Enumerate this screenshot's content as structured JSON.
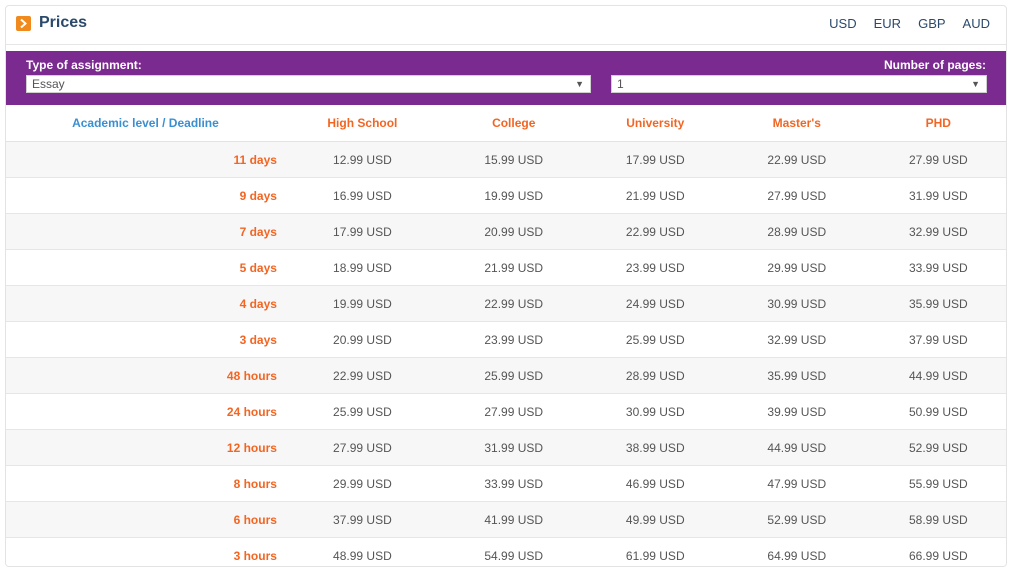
{
  "header": {
    "title": "Prices",
    "icon": "chevron-right-icon",
    "currencies": [
      "USD",
      "EUR",
      "GBP",
      "AUD"
    ]
  },
  "filters": {
    "assignment_label": "Type of assignment:",
    "assignment_value": "Essay",
    "pages_label": "Number of pages:",
    "pages_value": "1"
  },
  "table": {
    "headers": [
      "Academic level / Deadline",
      "High School",
      "College",
      "University",
      "Master's",
      "PHD"
    ],
    "rows": [
      [
        "11 days",
        "12.99 USD",
        "15.99 USD",
        "17.99 USD",
        "22.99 USD",
        "27.99 USD"
      ],
      [
        "9 days",
        "16.99 USD",
        "19.99 USD",
        "21.99 USD",
        "27.99 USD",
        "31.99 USD"
      ],
      [
        "7 days",
        "17.99 USD",
        "20.99 USD",
        "22.99 USD",
        "28.99 USD",
        "32.99 USD"
      ],
      [
        "5 days",
        "18.99 USD",
        "21.99 USD",
        "23.99 USD",
        "29.99 USD",
        "33.99 USD"
      ],
      [
        "4 days",
        "19.99 USD",
        "22.99 USD",
        "24.99 USD",
        "30.99 USD",
        "35.99 USD"
      ],
      [
        "3 days",
        "20.99 USD",
        "23.99 USD",
        "25.99 USD",
        "32.99 USD",
        "37.99 USD"
      ],
      [
        "48 hours",
        "22.99 USD",
        "25.99 USD",
        "28.99 USD",
        "35.99 USD",
        "44.99 USD"
      ],
      [
        "24 hours",
        "25.99 USD",
        "27.99 USD",
        "30.99 USD",
        "39.99 USD",
        "50.99 USD"
      ],
      [
        "12 hours",
        "27.99 USD",
        "31.99 USD",
        "38.99 USD",
        "44.99 USD",
        "52.99 USD"
      ],
      [
        "8 hours",
        "29.99 USD",
        "33.99 USD",
        "46.99 USD",
        "47.99 USD",
        "55.99 USD"
      ],
      [
        "6 hours",
        "37.99 USD",
        "41.99 USD",
        "49.99 USD",
        "52.99 USD",
        "58.99 USD"
      ],
      [
        "3 hours",
        "48.99 USD",
        "54.99 USD",
        "61.99 USD",
        "64.99 USD",
        "66.99 USD"
      ]
    ]
  },
  "colors": {
    "accent_orange": "#f26522",
    "filter_purple": "#7b2a8f",
    "title_blue": "#2b4a6b",
    "header_link_blue": "#3a8fd1"
  }
}
